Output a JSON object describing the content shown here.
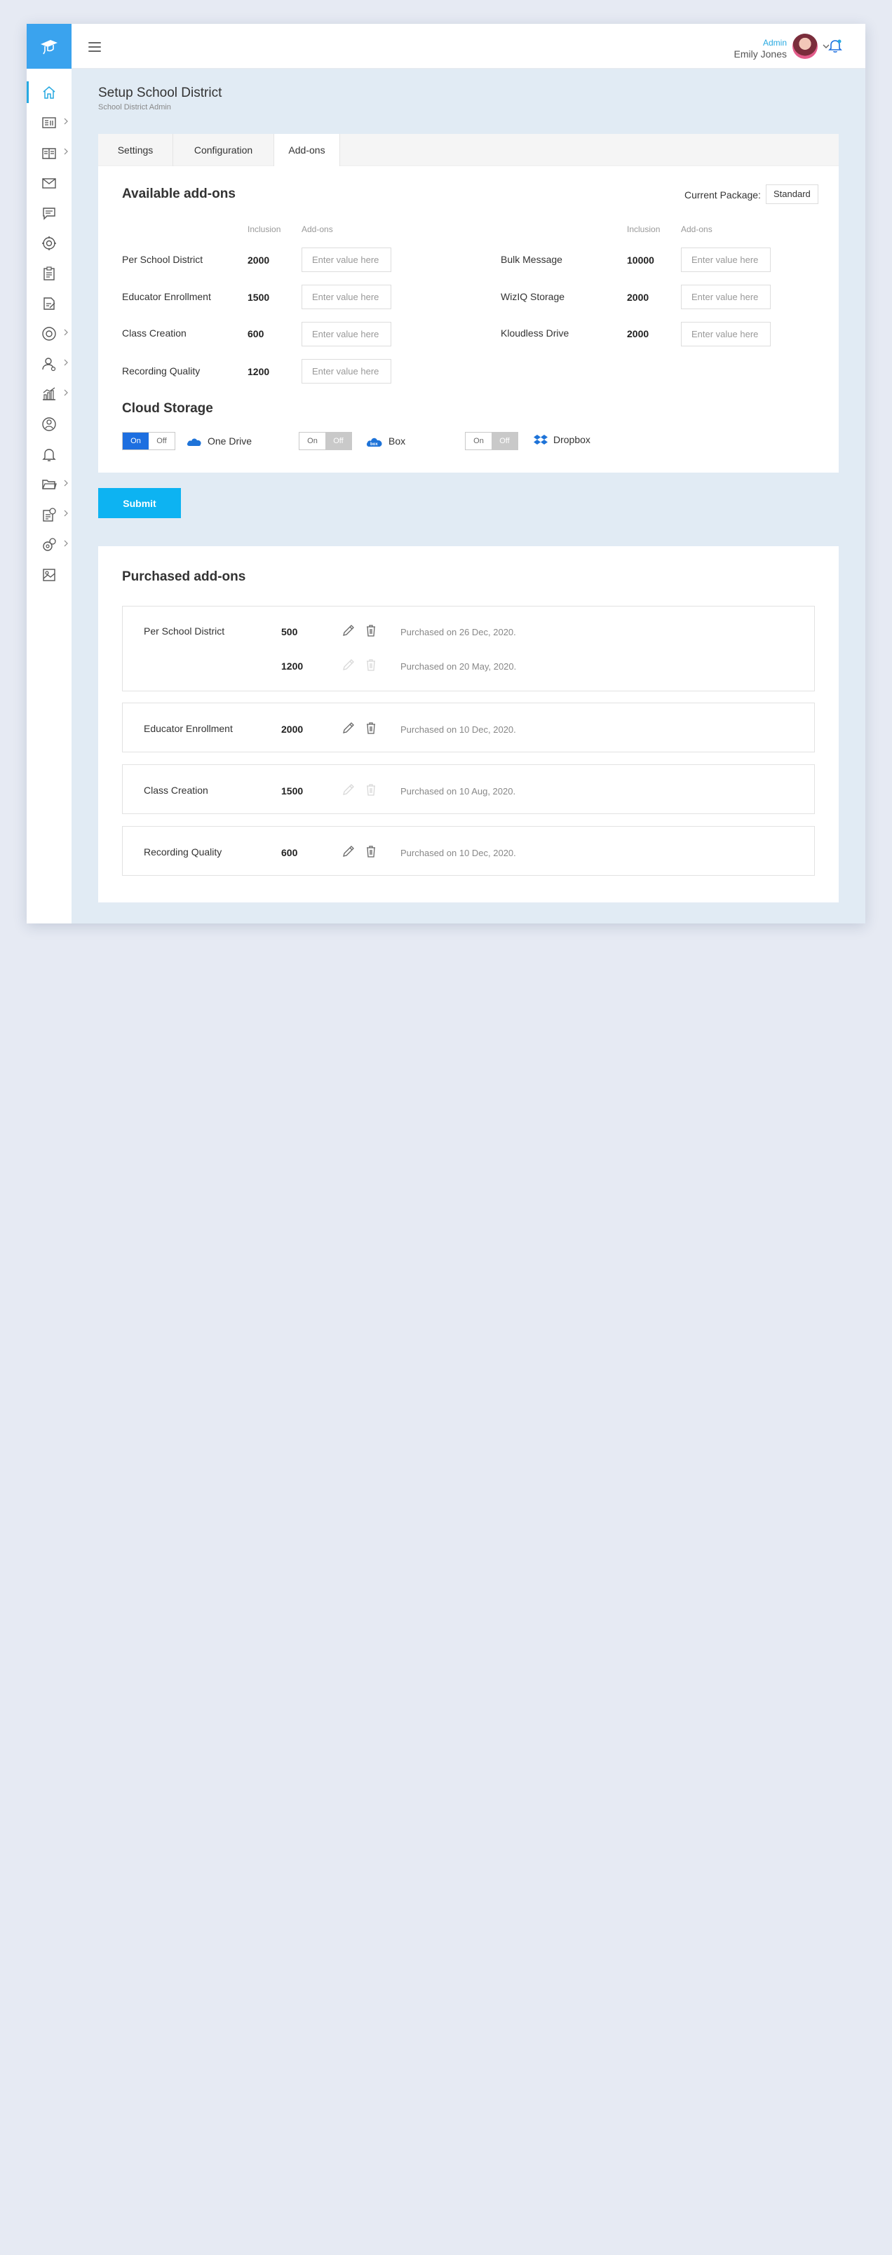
{
  "header": {
    "role": "Admin",
    "user_name": "Emily Jones"
  },
  "page": {
    "title": "Setup School District",
    "subtitle": "School District Admin"
  },
  "tabs": [
    {
      "label": "Settings"
    },
    {
      "label": "Configuration"
    },
    {
      "label": "Add-ons"
    }
  ],
  "available": {
    "title": "Available add-ons",
    "current_package_label": "Current Package:",
    "current_package": "Standard",
    "col_inclusion": "Inclusion",
    "col_addons": "Add-ons",
    "placeholder": "Enter value here",
    "left": [
      {
        "label": "Per School District",
        "inclusion": "2000"
      },
      {
        "label": "Educator Enrollment",
        "inclusion": "1500"
      },
      {
        "label": "Class Creation",
        "inclusion": "600"
      },
      {
        "label": "Recording Quality",
        "inclusion": "1200"
      }
    ],
    "right": [
      {
        "label": "Bulk Message",
        "inclusion": "10000"
      },
      {
        "label": "WizIQ Storage",
        "inclusion": "2000"
      },
      {
        "label": "Kloudless Drive",
        "inclusion": "2000"
      }
    ]
  },
  "cloud": {
    "title": "Cloud Storage",
    "on_label": "On",
    "off_label": "Off",
    "providers": [
      {
        "name": "One Drive",
        "state": "on",
        "icon": "onedrive-icon"
      },
      {
        "name": "Box",
        "state": "off",
        "icon": "box-icon"
      },
      {
        "name": "Dropbox",
        "state": "off",
        "icon": "dropbox-icon"
      }
    ]
  },
  "submit_label": "Submit",
  "purchased": {
    "title": "Purchased add-ons",
    "items": [
      {
        "label": "Per School District",
        "entries": [
          {
            "value": "500",
            "date": "Purchased on 26 Dec, 2020.",
            "editable": true
          },
          {
            "value": "1200",
            "date": "Purchased on 20 May, 2020.",
            "editable": false
          }
        ]
      },
      {
        "label": "Educator Enrollment",
        "entries": [
          {
            "value": "2000",
            "date": "Purchased on 10 Dec, 2020.",
            "editable": true
          }
        ]
      },
      {
        "label": "Class Creation",
        "entries": [
          {
            "value": "1500",
            "date": "Purchased on 10 Aug, 2020.",
            "editable": false
          }
        ]
      },
      {
        "label": "Recording Quality",
        "entries": [
          {
            "value": "600",
            "date": "Purchased on 10 Dec, 2020.",
            "editable": true
          }
        ]
      }
    ]
  },
  "colors": {
    "accent": "#27a9e1",
    "brand": "#3aa3ee",
    "submit": "#0db3f2",
    "toggle_on": "#1d6fe0"
  },
  "sidebar_icons": [
    "home-icon",
    "courses-icon",
    "books-icon",
    "mail-icon",
    "chat-icon",
    "settings-icon",
    "clipboard-icon",
    "assignment-icon",
    "lifebuoy-icon",
    "user-icon",
    "analytics-icon",
    "support-icon",
    "notification-icon",
    "folder-icon",
    "report-icon",
    "config-icon",
    "gallery-icon"
  ]
}
